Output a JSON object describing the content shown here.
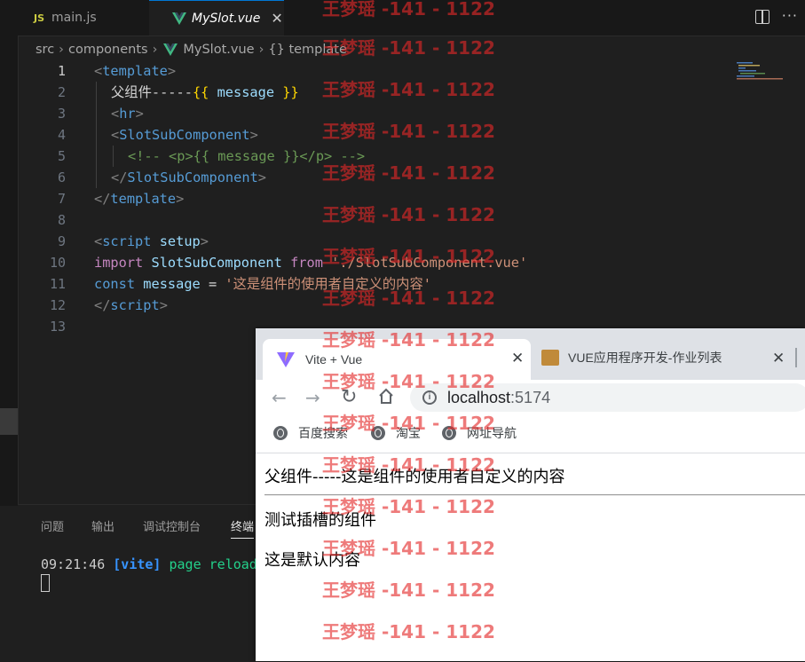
{
  "editor": {
    "tabs": [
      {
        "label": "main.js",
        "badge": "JS"
      },
      {
        "label": "MySlot.vue"
      }
    ],
    "breadcrumb": [
      "src",
      "components",
      "MySlot.vue",
      "{} template"
    ],
    "lines": [
      {
        "n": "1"
      },
      {
        "n": "2"
      },
      {
        "n": "3"
      },
      {
        "n": "4"
      },
      {
        "n": "5"
      },
      {
        "n": "6"
      },
      {
        "n": "7"
      },
      {
        "n": "8"
      },
      {
        "n": "9"
      },
      {
        "n": "10"
      },
      {
        "n": "11"
      },
      {
        "n": "12"
      },
      {
        "n": "13"
      }
    ],
    "code": {
      "l1_tag": "template",
      "l2_text": "父组件-----",
      "l2_open": "{{",
      "l2_var": " message ",
      "l2_close": "}}",
      "l3_tag": "hr",
      "l4_tag": "SlotSubComponent",
      "l5_comment": "<!-- <p>{{ message }}</p> -->",
      "l6_tag": "SlotSubComponent",
      "l7_tag": "template",
      "l9_tag": "script",
      "l9_attr": "setup",
      "l10_import": "import",
      "l10_name": "SlotSubComponent",
      "l10_from": "from",
      "l10_path": "'./SlotSubComponent.vue'",
      "l11_const": "const",
      "l11_name": "message",
      "l11_eq": " = ",
      "l11_value": "'这是组件的使用者自定义的内容'",
      "l12_tag": "script"
    }
  },
  "panel": {
    "tabs": [
      "问题",
      "输出",
      "调试控制台",
      "终端"
    ],
    "terminal": {
      "time": "09:21:46",
      "tag": "[vite]",
      "message": "page reload"
    }
  },
  "browser": {
    "tabs": [
      {
        "title": "Vite + Vue"
      },
      {
        "title": "VUE应用程序开发-作业列表"
      }
    ],
    "url_host": "localhost",
    "url_port": ":5174",
    "bookmarks": [
      "百度搜索",
      "淘宝",
      "网址导航"
    ],
    "page": {
      "heading": "父组件-----这是组件的使用者自定义的内容",
      "slot_title": "测试插槽的组件",
      "slot_default": "这是默认内容"
    }
  },
  "watermark": "王梦瑶 -141 - 1122",
  "colors": {
    "vue_green": "#41b883",
    "vue_dark": "#34495e",
    "accent": "#0078d4"
  }
}
